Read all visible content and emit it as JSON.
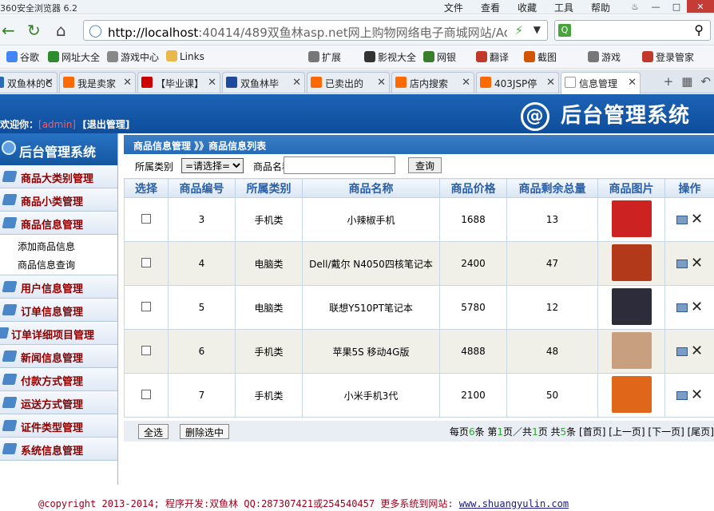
{
  "browser": {
    "title": "360安全浏览器 6.2",
    "menus": [
      "文件",
      "查看",
      "收藏",
      "工具",
      "帮助"
    ],
    "url_host": "http://localhost",
    "url_rest": ":40414/489双鱼林asp.net网上购物网络电子商城网站/Adm",
    "search_icon": "search-icon",
    "bookmarks": [
      {
        "label": "谷歌",
        "color": "#4285f4"
      },
      {
        "label": "网址大全",
        "color": "#2e8b2e"
      },
      {
        "label": "游戏中心",
        "color": "#888888"
      },
      {
        "label": "Links",
        "color": "#e8b84a"
      },
      {
        "label": "扩展",
        "color": "#777777"
      },
      {
        "label": "影视大全",
        "color": "#333333"
      },
      {
        "label": "网银",
        "color": "#3a7d2c"
      },
      {
        "label": "翻译",
        "color": "#c0392b"
      },
      {
        "label": "截图",
        "color": "#d35400"
      },
      {
        "label": "游戏",
        "color": "#777777"
      },
      {
        "label": "登录管家",
        "color": "#c0392b"
      }
    ],
    "tabs": [
      {
        "label": "双鱼林的C",
        "color": "#2a6bb8"
      },
      {
        "label": "我是卖家",
        "color": "#ff6a00"
      },
      {
        "label": "【毕业课】",
        "color": "#cc0000"
      },
      {
        "label": "双鱼林毕",
        "color": "#1e4a9c"
      },
      {
        "label": "已卖出的",
        "color": "#ff6a00"
      },
      {
        "label": "店内搜索",
        "color": "#ff6a00"
      },
      {
        "label": "403JSP停",
        "color": "#ff6a00"
      },
      {
        "label": "信息管理",
        "color": "#ffffff"
      }
    ]
  },
  "header": {
    "welcome": "欢迎你：",
    "user": "[admin]",
    "logout": "[退出管理]",
    "logo_text": "后台管理系统"
  },
  "sidebar": {
    "title": "后台管理系统",
    "items": [
      {
        "label": "商品大类别管理"
      },
      {
        "label": "商品小类管理"
      },
      {
        "label": "商品信息管理"
      }
    ],
    "subitems": [
      "添加商品信息",
      "商品信息查询"
    ],
    "items2": [
      {
        "label": "用户信息管理"
      },
      {
        "label": "订单信息管理"
      },
      {
        "label": "订单详细项目管理"
      },
      {
        "label": "新闻信息管理"
      },
      {
        "label": "付款方式管理"
      },
      {
        "label": "运送方式管理"
      },
      {
        "label": "证件类型管理"
      },
      {
        "label": "系统信息管理"
      }
    ]
  },
  "main": {
    "breadcrumb": "商品信息管理 》》商品信息列表",
    "filter": {
      "category_label": "所属类别",
      "category_value": "=请选择=",
      "name_label": "商品名称",
      "name_value": "",
      "query_button": "查询"
    },
    "columns": [
      "选择",
      "商品编号",
      "所属类别",
      "商品名称",
      "商品价格",
      "商品剩余总量",
      "商品图片",
      "操作"
    ],
    "rows": [
      {
        "id": "3",
        "category": "手机类",
        "name": "小辣椒手机",
        "price": "1688",
        "stock": "13",
        "img_color": "#cc2222"
      },
      {
        "id": "4",
        "category": "电脑类",
        "name": "Dell/戴尔 N4050四核笔记本",
        "price": "2400",
        "stock": "47",
        "img_color": "#b23a1a"
      },
      {
        "id": "5",
        "category": "电脑类",
        "name": "联想Y510PT笔记本",
        "price": "5780",
        "stock": "12",
        "img_color": "#2c2c3a"
      },
      {
        "id": "6",
        "category": "手机类",
        "name": "苹果5S 移动4G版",
        "price": "4888",
        "stock": "48",
        "img_color": "#c8a080"
      },
      {
        "id": "7",
        "category": "手机类",
        "name": "小米手机3代",
        "price": "2100",
        "stock": "50",
        "img_color": "#e0661a"
      }
    ],
    "footer": {
      "select_all": "全选",
      "delete_selected": "删除选中",
      "per_page_prefix": "每页",
      "per_page": "6",
      "per_page_suffix": "条 第",
      "current_page": "1",
      "page_mid": "页／共",
      "total_pages": "1",
      "page_total_suffix": "页 共",
      "total_records": "5",
      "records_suffix": "条",
      "first": "[首页]",
      "prev": "[上一页]",
      "next": "[下一页]",
      "last": "[尾页]"
    }
  },
  "copyright": {
    "text": "@copyright 2013-2014; 程序开发:双鱼林  QQ:287307421或254540457  更多系统到网站: ",
    "link": "www.shuangyulin.com"
  }
}
